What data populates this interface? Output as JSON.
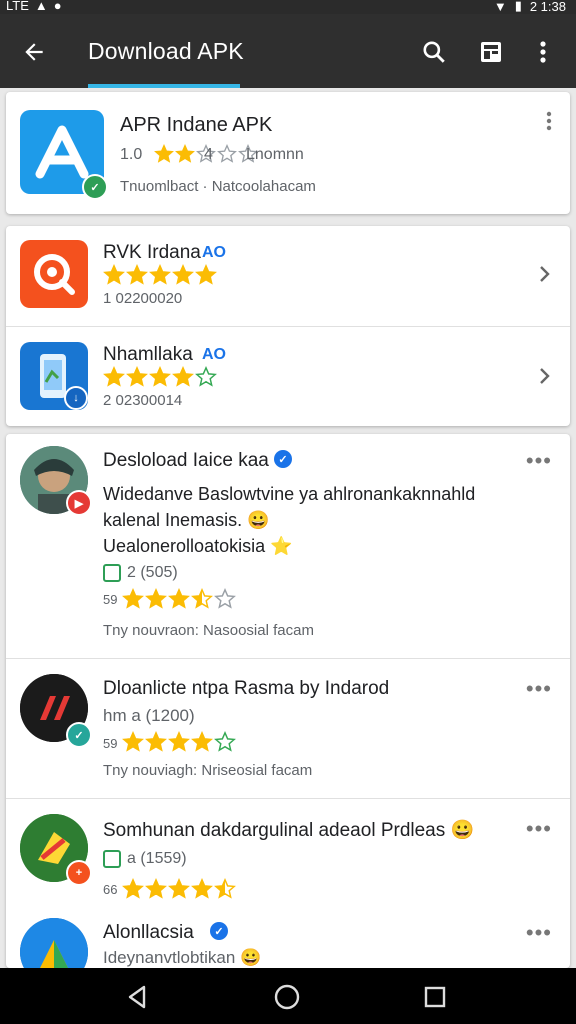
{
  "status_bar": {
    "time": "2 1:38",
    "left_glyphs": [
      "LTE",
      "▲",
      "●"
    ]
  },
  "app_bar": {
    "title": "Download APK",
    "back_icon": "arrow-left-icon",
    "actions": [
      "search-icon",
      "grid-icon",
      "more-vert-icon"
    ]
  },
  "featured": {
    "title": "APR Indane APK",
    "rating_text": "1.0",
    "rating_extra": "4",
    "rating_suffix": "Lnomnn",
    "meta": "Tnuomlbact · Natcoolahacam",
    "stars": 2.0
  },
  "list": [
    {
      "title": "RVK Irdana",
      "tag": "AO",
      "stars": 5.0,
      "meta": "1 02200020",
      "icon": "search-app-icon"
    },
    {
      "title": "Nhamllaka",
      "tag": "AO",
      "stars": 4.0,
      "meta": "2 02300014",
      "icon": "phone-app-icon"
    }
  ],
  "posts": [
    {
      "author": "Desloload Iaice kaa",
      "verified": true,
      "line1": "Widedanve Baslowtvine ya ahlronankaknnahld",
      "line2": "kalenal Inemasis. 😀",
      "line3": "Uealonerolloatokisia ⭐",
      "count_label": "2 (505)",
      "rating_num": "59",
      "stars": 3.5,
      "footer": "Tny nouvraon: Nasoosial facam"
    },
    {
      "author": "Dloanlicte ntpa Rasma by Indarod",
      "verified": false,
      "line1": "hm a (1200)",
      "rating_num": "59",
      "stars": 4.0,
      "footer": "Tny nouviagh: Nriseosial facam"
    },
    {
      "author": "Somhunan dakdargulinal adeaol Prdleas 😀",
      "verified": false,
      "count_label": "a (1559)",
      "rating_num": "66",
      "stars": 4.5
    },
    {
      "author": "Alonllacsia",
      "verified": true,
      "line1": "Ideynanvtlobtikan 😀"
    }
  ],
  "nav_bar": {
    "buttons": [
      "back-triangle-icon",
      "home-circle-icon",
      "recents-square-icon"
    ]
  },
  "colors": {
    "app_bar": "#2f2f2f",
    "accent": "#36b6e6",
    "star": "#fbbc04",
    "star_empty": "#9aa0a6",
    "verified": "#1a73e8"
  }
}
